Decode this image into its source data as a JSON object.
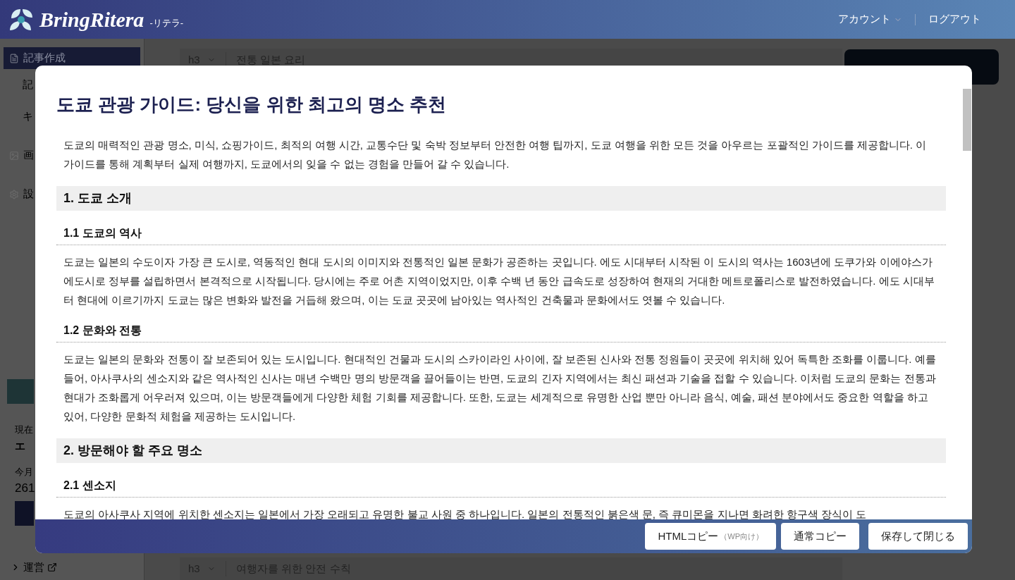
{
  "header": {
    "brand": "BringRitera",
    "subtitle": "-リテラ-",
    "account": "アカウント",
    "logout": "ログアウト"
  },
  "sidebar": {
    "items": [
      {
        "label": "記事作成",
        "kind": "doc",
        "selected": true
      },
      {
        "label": "記",
        "kind": "sub",
        "selected": false
      },
      {
        "label": "キ",
        "kind": "sub",
        "selected": false
      },
      {
        "label": "画",
        "kind": "image",
        "selected": false
      },
      {
        "label": "設",
        "kind": "gear",
        "selected": false
      }
    ],
    "stats": {
      "label_1": "現在",
      "value_1": "エ",
      "label_2": "今月",
      "value_2": "261"
    },
    "footer_link": "運営"
  },
  "editor_rows": [
    {
      "tag": "h3",
      "text": "전통 일본 요리"
    },
    {
      "tag": "h3",
      "text": "여행자를 위한 안전 수칙"
    }
  ],
  "modal": {
    "title": "도쿄 관광 가이드: 당신을 위한 최고의 명소 추천",
    "blocks": [
      {
        "kind": "p",
        "text": "도쿄의 매력적인 관광 명소, 미식, 쇼핑가이드, 최적의 여행 시간, 교통수단 및 숙박 정보부터 안전한 여행 팁까지, 도쿄 여행을 위한 모든 것을 아우르는 포괄적인 가이드를 제공합니다. 이 가이드를 통해 계획부터 실제 여행까지, 도쿄에서의 잊을 수 없는 경험을 만들어 갈 수 있습니다."
      },
      {
        "kind": "h2",
        "text": "1. 도쿄 소개"
      },
      {
        "kind": "h3",
        "text": "1.1 도쿄의 역사"
      },
      {
        "kind": "p",
        "text": "도쿄는 일본의 수도이자 가장 큰 도시로, 역동적인 현대 도시의 이미지와 전통적인 일본 문화가 공존하는 곳입니다. 에도 시대부터 시작된 이 도시의 역사는 1603년에 도쿠가와 이에야스가 에도시로 정부를 설립하면서 본격적으로 시작됩니다. 당시에는 주로 어촌 지역이었지만, 이후 수백 년 동안 급속도로 성장하여 현재의 거대한 메트로폴리스로 발전하였습니다. 에도 시대부터 현대에 이르기까지 도쿄는 많은 변화와 발전을 거듭해 왔으며, 이는 도쿄 곳곳에 남아있는 역사적인 건축물과 문화에서도 엿볼 수 있습니다."
      },
      {
        "kind": "h3",
        "text": "1.2 문화와 전통"
      },
      {
        "kind": "p",
        "text": "도쿄는 일본의 문화와 전통이 잘 보존되어 있는 도시입니다. 현대적인 건물과 도시의 스카이라인 사이에, 잘 보존된 신사와 전통 정원들이 곳곳에 위치해 있어 독특한 조화를 이룹니다. 예를 들어, 아사쿠사의 센소지와 같은 역사적인 신사는 매년 수백만 명의 방문객을 끌어들이는 반면, 도쿄의 긴자 지역에서는 최신 패션과 기술을 접할 수 있습니다. 이처럼 도쿄의 문화는 전통과 현대가 조화롭게 어우러져 있으며, 이는 방문객들에게 다양한 체험 기회를 제공합니다. 또한, 도쿄는 세계적으로 유명한 산업 뿐만 아니라 음식, 예술, 패션 분야에서도 중요한 역할을 하고 있어, 다양한 문화적 체험을 제공하는 도시입니다."
      },
      {
        "kind": "h2",
        "text": "2. 방문해야 할 주요 명소"
      },
      {
        "kind": "h3",
        "text": "2.1 센소지"
      },
      {
        "kind": "p",
        "text": "도쿄의 아사쿠사 지역에 위치한 센소지는 일본에서 가장 오래되고 유명한 불교 사원 중 하나입니다. 일본의 전통적인 붉은색 문, 즉 큐미몬을 지나면 화려한 항구색 장식이 도"
      }
    ],
    "buttons": [
      {
        "label": "HTMLコピー",
        "note": "（WP向け）"
      },
      {
        "label": "通常コピー"
      },
      {
        "label": "保存して閉じる"
      }
    ]
  }
}
